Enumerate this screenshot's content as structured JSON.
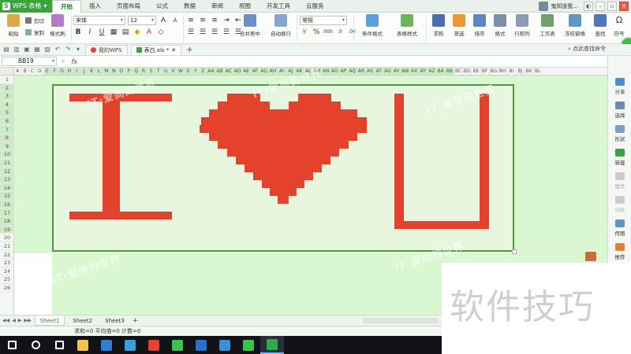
{
  "app": {
    "name": "WPS 表格",
    "tabs": [
      "开始",
      "插入",
      "页面布局",
      "公式",
      "数据",
      "审阅",
      "视图",
      "开发工具",
      "云服务"
    ],
    "active_tab": "开始",
    "user_name": "鬼知道我..."
  },
  "ribbon": {
    "paste": "粘贴",
    "cut": "剪切",
    "copy": "复制",
    "format_painter": "格式刷",
    "font_name": "宋体",
    "font_size": "12",
    "merge_center": "合并居中",
    "wrap_text": "自动换行",
    "number_format": "常规",
    "conditional_format": "条件格式",
    "table_style": "表格样式",
    "sum": "求和",
    "filter": "筛选",
    "sort": "排序",
    "format": "格式",
    "row_col": "行和列",
    "worksheet": "工作表",
    "freeze": "冻结窗格",
    "find": "查找",
    "symbol": "符号",
    "bold": "B",
    "italic": "I",
    "underline": "U",
    "percent": "%",
    "thousand": "000"
  },
  "docbar": {
    "tabs": [
      {
        "label": "我的WPS",
        "active": false
      },
      {
        "label": "表白.xls *",
        "active": true
      }
    ],
    "search_label": "点此查找命令"
  },
  "formula_bar": {
    "name_box": "BB19",
    "fx": "fx",
    "content": ""
  },
  "grid": {
    "columns": [
      "A",
      "B",
      "C",
      "D",
      "E",
      "F",
      "G",
      "H",
      "I",
      "J",
      "K",
      "L",
      "M",
      "N",
      "O",
      "P",
      "Q",
      "R",
      "S",
      "T",
      "U",
      "V",
      "W",
      "X",
      "Y",
      "Z",
      "AA",
      "AB",
      "AC",
      "AD",
      "AE",
      "AF",
      "AG",
      "AH",
      "AI",
      "AJ",
      "AK",
      "AL",
      "AM",
      "AN",
      "AO",
      "AP",
      "AQ",
      "AR",
      "AS",
      "AT",
      "AU",
      "AV",
      "AW",
      "AX",
      "AY",
      "AZ",
      "BA",
      "BB",
      "BC",
      "BD",
      "BE",
      "BF",
      "BG",
      "BH",
      "BI",
      "BJ",
      "BK",
      "BL"
    ],
    "selected_columns_range": [
      "E",
      "BB"
    ],
    "rows": [
      "1",
      "2",
      "3",
      "4",
      "5",
      "6",
      "7",
      "8",
      "9",
      "10",
      "11",
      "12",
      "13",
      "14",
      "15",
      "16",
      "17",
      "18",
      "19",
      "20",
      "21",
      "22",
      "23",
      "24",
      "25",
      "26"
    ],
    "selected_rows_range": [
      "2",
      "19"
    ],
    "art_fill_color": "#e3432c",
    "art_bg_color": "#e8f6e0",
    "sheet_bg_color": "#d9f8d2",
    "watermark": "IT·爱尚的世界"
  },
  "right_pane": {
    "items": [
      {
        "label": "分享",
        "icon": "share-icon",
        "enabled": true
      },
      {
        "label": "选择",
        "icon": "select-icon",
        "enabled": true
      },
      {
        "label": "形状",
        "icon": "shape-icon",
        "enabled": true
      },
      {
        "label": "新建",
        "icon": "new-icon",
        "enabled": true
      },
      {
        "label": "属性",
        "icon": "property-icon",
        "enabled": false
      },
      {
        "label": "分析",
        "icon": "analysis-icon",
        "enabled": false
      },
      {
        "label": "传图",
        "icon": "upload-image-icon",
        "enabled": true
      },
      {
        "label": "推荐",
        "icon": "recommend-icon",
        "enabled": true
      }
    ]
  },
  "sheets": {
    "tabs": [
      "Sheet1",
      "Sheet2",
      "Sheet3"
    ],
    "active": "Sheet1"
  },
  "status": {
    "text": "求和=0   平均值=0   计数=0"
  },
  "caption": "软件技巧",
  "taskbar": {
    "icons": [
      "windows-start-icon",
      "search-circle-icon",
      "task-view-icon",
      "folder-icon",
      "edge-icon",
      "bird-app-icon",
      "office-icon",
      "wechat-icon",
      "k-app-icon",
      "settings-icon",
      "360-icon",
      "wps-icon"
    ]
  }
}
